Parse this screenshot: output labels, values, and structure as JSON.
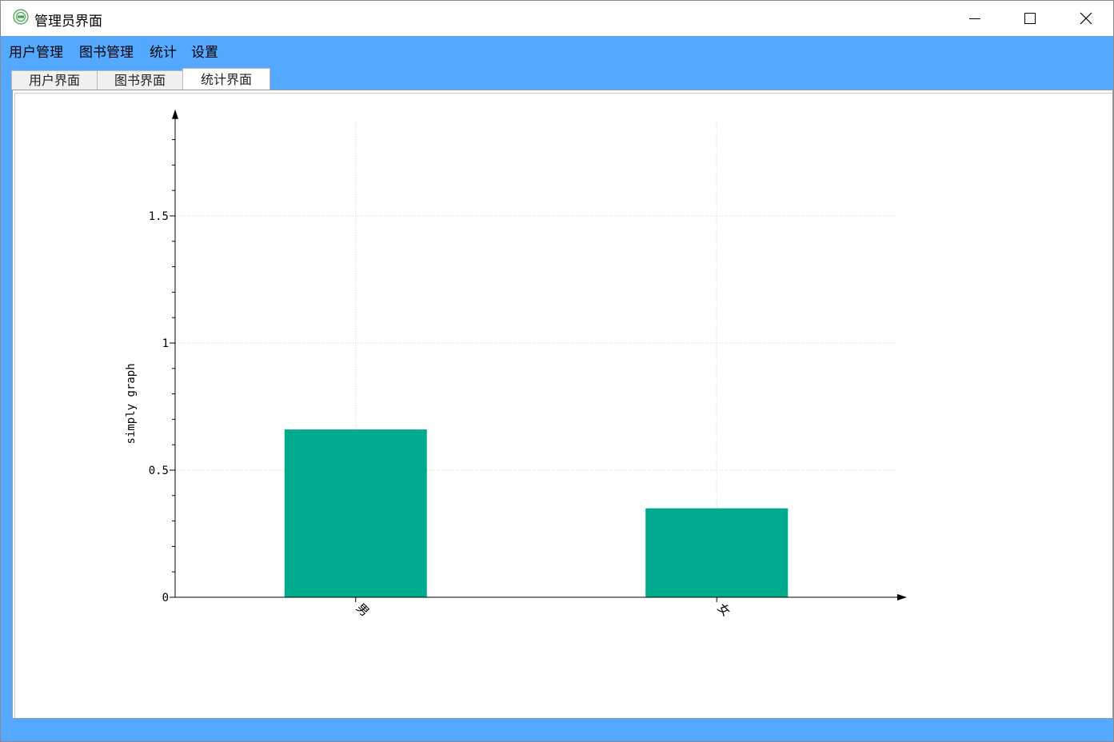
{
  "window": {
    "title": "管理员界面",
    "controls": {
      "minimize": "—",
      "maximize": "☐",
      "close": "✕"
    }
  },
  "menu": {
    "items": [
      {
        "label": "用户管理"
      },
      {
        "label": "图书管理"
      },
      {
        "label": "统计"
      },
      {
        "label": "设置"
      }
    ]
  },
  "tabs": [
    {
      "label": "用户界面",
      "active": false
    },
    {
      "label": "图书界面",
      "active": false
    },
    {
      "label": "统计界面",
      "active": true
    }
  ],
  "colors": {
    "accent": "#55a8ff",
    "bar": "#00aa8c"
  },
  "chart_data": {
    "type": "bar",
    "categories": [
      "男",
      "女"
    ],
    "values": [
      0.66,
      0.35
    ],
    "title": "",
    "xlabel": "",
    "ylabel": "simply graph",
    "ylim": [
      0,
      1.9
    ],
    "yticks": [
      0,
      0.5,
      1,
      1.5
    ],
    "ytick_labels": [
      "0",
      "0.5",
      "1",
      "1.5"
    ],
    "grid": true,
    "legend": "none"
  }
}
